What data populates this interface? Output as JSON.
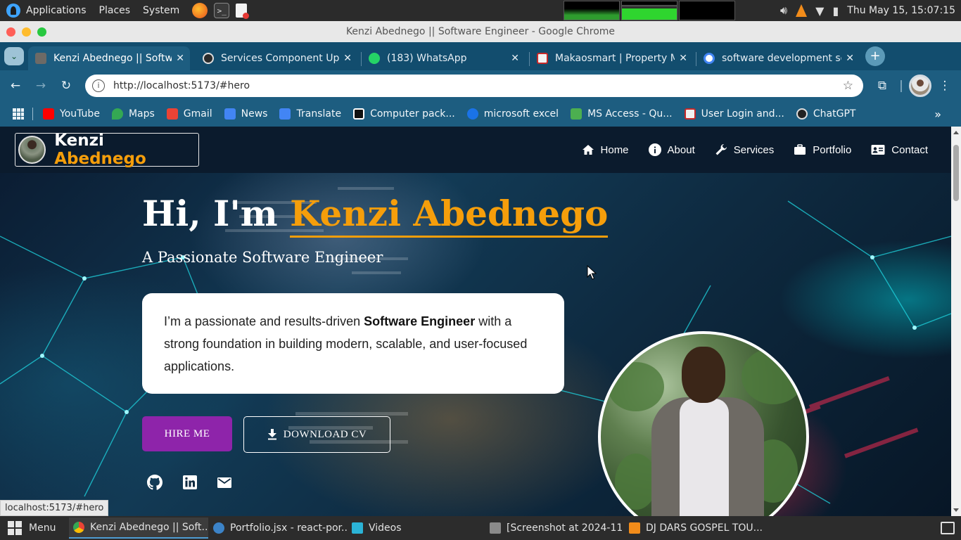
{
  "os_panel": {
    "menus": [
      "Applications",
      "Places",
      "System"
    ],
    "clock": "Thu May 15, 15:07:15"
  },
  "window": {
    "title": "Kenzi Abednego || Software Engineer - Google Chrome"
  },
  "tabs": [
    {
      "title": "Kenzi Abednego || Software Engineer",
      "active": true
    },
    {
      "title": "Services Component Update",
      "active": false
    },
    {
      "title": "(183) WhatsApp",
      "active": false
    },
    {
      "title": "Makaosmart | Property Management",
      "active": false
    },
    {
      "title": "software development services",
      "active": false
    }
  ],
  "toolbar": {
    "url": "http://localhost:5173/#hero"
  },
  "bookmarks": [
    {
      "label": "YouTube",
      "color": "#ff0000"
    },
    {
      "label": "Maps",
      "color": "#34a853"
    },
    {
      "label": "Gmail",
      "color": "#ea4335"
    },
    {
      "label": "News",
      "color": "#4285f4"
    },
    {
      "label": "Translate",
      "color": "#4285f4"
    },
    {
      "label": "Computer pack...",
      "color": "#111111"
    },
    {
      "label": "microsoft excel",
      "color": "#1a73e8"
    },
    {
      "label": "MS Access - Qu...",
      "color": "#4caf50"
    },
    {
      "label": "User Login and...",
      "color": "#f1f1f1"
    },
    {
      "label": "ChatGPT",
      "color": "#222222"
    }
  ],
  "site": {
    "brand_first": "Kenzi",
    "brand_last": "Abednego",
    "nav": [
      {
        "label": "Home",
        "icon": "home-icon"
      },
      {
        "label": "About",
        "icon": "info-icon"
      },
      {
        "label": "Services",
        "icon": "wrench-icon"
      },
      {
        "label": "Portfolio",
        "icon": "briefcase-icon"
      },
      {
        "label": "Contact",
        "icon": "contact-card-icon"
      }
    ],
    "hero": {
      "greeting": "Hi, I'm ",
      "name": "Kenzi Abednego",
      "subtitle": "A Passionate Software Engineer",
      "about_before": "I’m a passionate and results-driven ",
      "about_bold": "Software Engineer",
      "about_after": " with a strong foundation in building modern, scalable, and user-focused applications.",
      "hire_label": "HIRE ME",
      "cv_label": "DOWNLOAD CV",
      "socials": [
        "github-icon",
        "linkedin-icon",
        "email-icon"
      ]
    },
    "accent": "#f59e0b",
    "button_color": "#8e24aa"
  },
  "status_url": "localhost:5173/#hero",
  "taskbar": {
    "menu_label": "Menu",
    "items": [
      {
        "label": "Kenzi Abednego || Soft...",
        "active": true
      },
      {
        "label": "Portfolio.jsx - react-por...",
        "active": false
      },
      {
        "label": "Videos",
        "active": false
      },
      {
        "label": "[Screenshot at 2024-11...",
        "active": false
      },
      {
        "label": "DJ DARS GOSPEL TOU...",
        "active": false
      }
    ]
  }
}
